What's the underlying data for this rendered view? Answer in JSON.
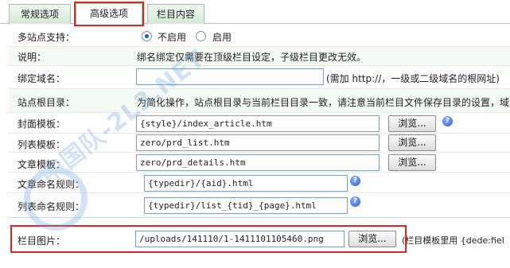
{
  "tabs": [
    {
      "label": "常规选项"
    },
    {
      "label": "高级选项"
    },
    {
      "label": "栏目内容"
    }
  ],
  "multisite": {
    "label": "多站点支持：",
    "option_off": "不启用",
    "option_on": "启用",
    "selected": "不启用"
  },
  "note": {
    "label": "说明：",
    "text": "绑名绑定仅需要在顶级栏目设定，子级栏目更改无效。"
  },
  "domain": {
    "label": "绑定域名：",
    "value": "",
    "hint": "(需加 http://，一级或二级域名的根网址)"
  },
  "siteroot": {
    "label": "站点根目录：",
    "text": "为简化操作，站点根目录与当前栏目目录一致，请注意当前栏目文件保存目录的设置，域"
  },
  "cover_tpl": {
    "label": "封面模板：",
    "value": "{style}/index_article.htm",
    "button": "浏览..."
  },
  "list_tpl": {
    "label": "列表模板：",
    "value": "zero/prd_list.htm",
    "button": "浏览..."
  },
  "article_tpl": {
    "label": "文章模板：",
    "value": "zero/prd_details.htm",
    "button": "浏览..."
  },
  "article_naming": {
    "label": "文章命名规则：",
    "value": "{typedir}/{aid}.html"
  },
  "list_naming": {
    "label": "列表命名规则：",
    "value": "{typedir}/list_{tid}_{page}.html"
  },
  "category_image": {
    "label": "栏目图片：",
    "value": "/uploads/141110/1-1411101105460.png",
    "button": "浏览...",
    "note": "(栏目模板里用 {dede:fiel"
  },
  "watermark": {
    "text": "中国队-2L3.NET"
  },
  "colors": {
    "highlight": "#e02424",
    "tab_active": "#ffffff",
    "tab_bg": "#d6ead8"
  }
}
